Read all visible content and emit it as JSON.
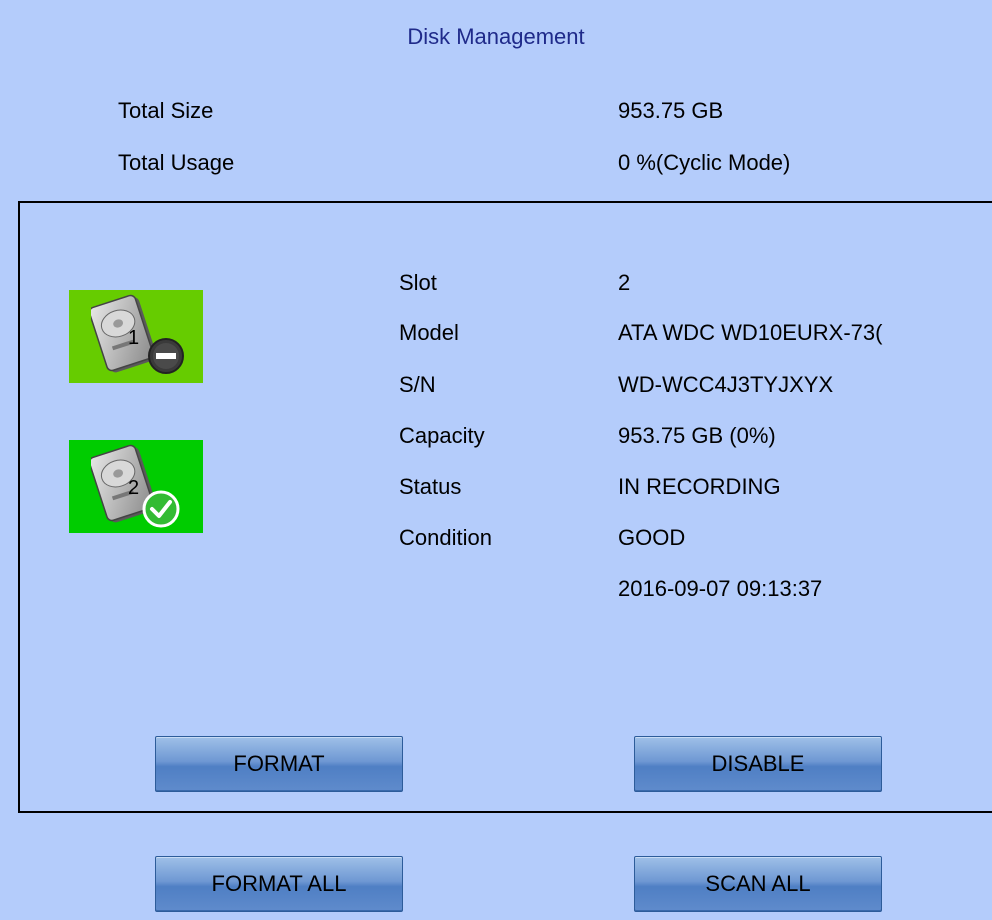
{
  "title": "Disk Management",
  "summary": {
    "total_size_label": "Total Size",
    "total_size_value": "953.75 GB",
    "total_usage_label": "Total Usage",
    "total_usage_value": "0 %(Cyclic Mode)"
  },
  "disks": [
    {
      "number": "1",
      "status_icon": "minus-badge-icon",
      "tile_color": "#66cc00"
    },
    {
      "number": "2",
      "status_icon": "check-badge-icon",
      "tile_color": "#00cc00"
    }
  ],
  "details": {
    "slot_label": "Slot",
    "slot_value": "2",
    "model_label": "Model",
    "model_value": "ATA WDC WD10EURX-73(",
    "sn_label": "S/N",
    "sn_value": "WD-WCC4J3TYJXYX",
    "capacity_label": "Capacity",
    "capacity_value": "953.75 GB (0%)",
    "status_label": "Status",
    "status_value": "IN RECORDING",
    "condition_label": "Condition",
    "condition_value": "GOOD",
    "timestamp": "2016-09-07 09:13:37"
  },
  "buttons": {
    "format": "FORMAT",
    "disable": "DISABLE",
    "format_all": "FORMAT ALL",
    "scan_all": "SCAN ALL"
  },
  "colors": {
    "background": "#b4ccfb",
    "title": "#1f2a8a",
    "button": "#6f98d3"
  }
}
